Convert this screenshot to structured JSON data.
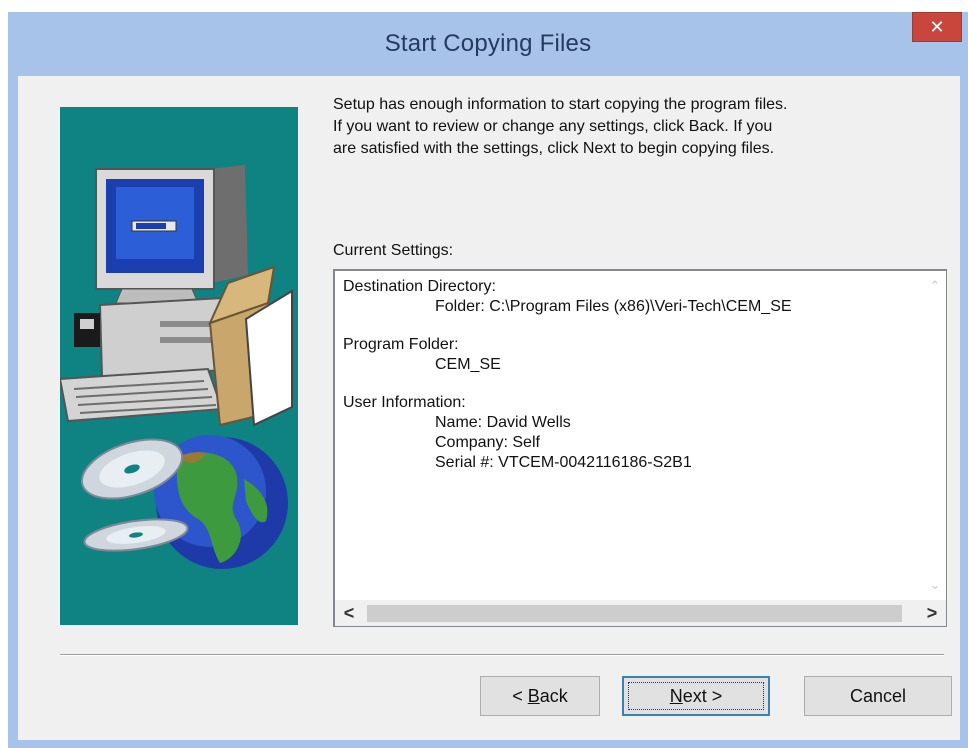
{
  "window": {
    "title": "Start Copying Files",
    "close_glyph": "✕"
  },
  "intro": {
    "lines": [
      "Setup has enough information to start copying the program files.",
      "If you want to review or change any settings, click Back.  If you",
      "are satisfied with the settings, click Next to begin copying files."
    ]
  },
  "settings": {
    "label": "Current Settings:",
    "destination_heading": "Destination Directory:",
    "destination_folder": "Folder: C:\\Program Files (x86)\\Veri-Tech\\CEM_SE",
    "program_folder_heading": "Program Folder:",
    "program_folder": "CEM_SE",
    "user_info_heading": "User Information:",
    "user_name": "Name: David Wells",
    "user_company": "Company: Self",
    "user_serial": "Serial #: VTCEM-0042116186-S2B1"
  },
  "scrollbar": {
    "up_arrow": "⌃",
    "down_arrow": "⌄",
    "left_arrow": "<",
    "right_arrow": ">"
  },
  "buttons": {
    "back_prefix": "< ",
    "back_key": "B",
    "back_rest": "ack",
    "next_key": "N",
    "next_rest": "ext >",
    "cancel": "Cancel"
  },
  "icons": {
    "side_illustration": "computer-cds-globe-illustration",
    "close": "close-icon"
  },
  "colors": {
    "title_bar": "#a7c3ea",
    "close_button": "#c9463d",
    "side_panel": "#0f8282",
    "dialog_bg": "#f0f0f0"
  }
}
